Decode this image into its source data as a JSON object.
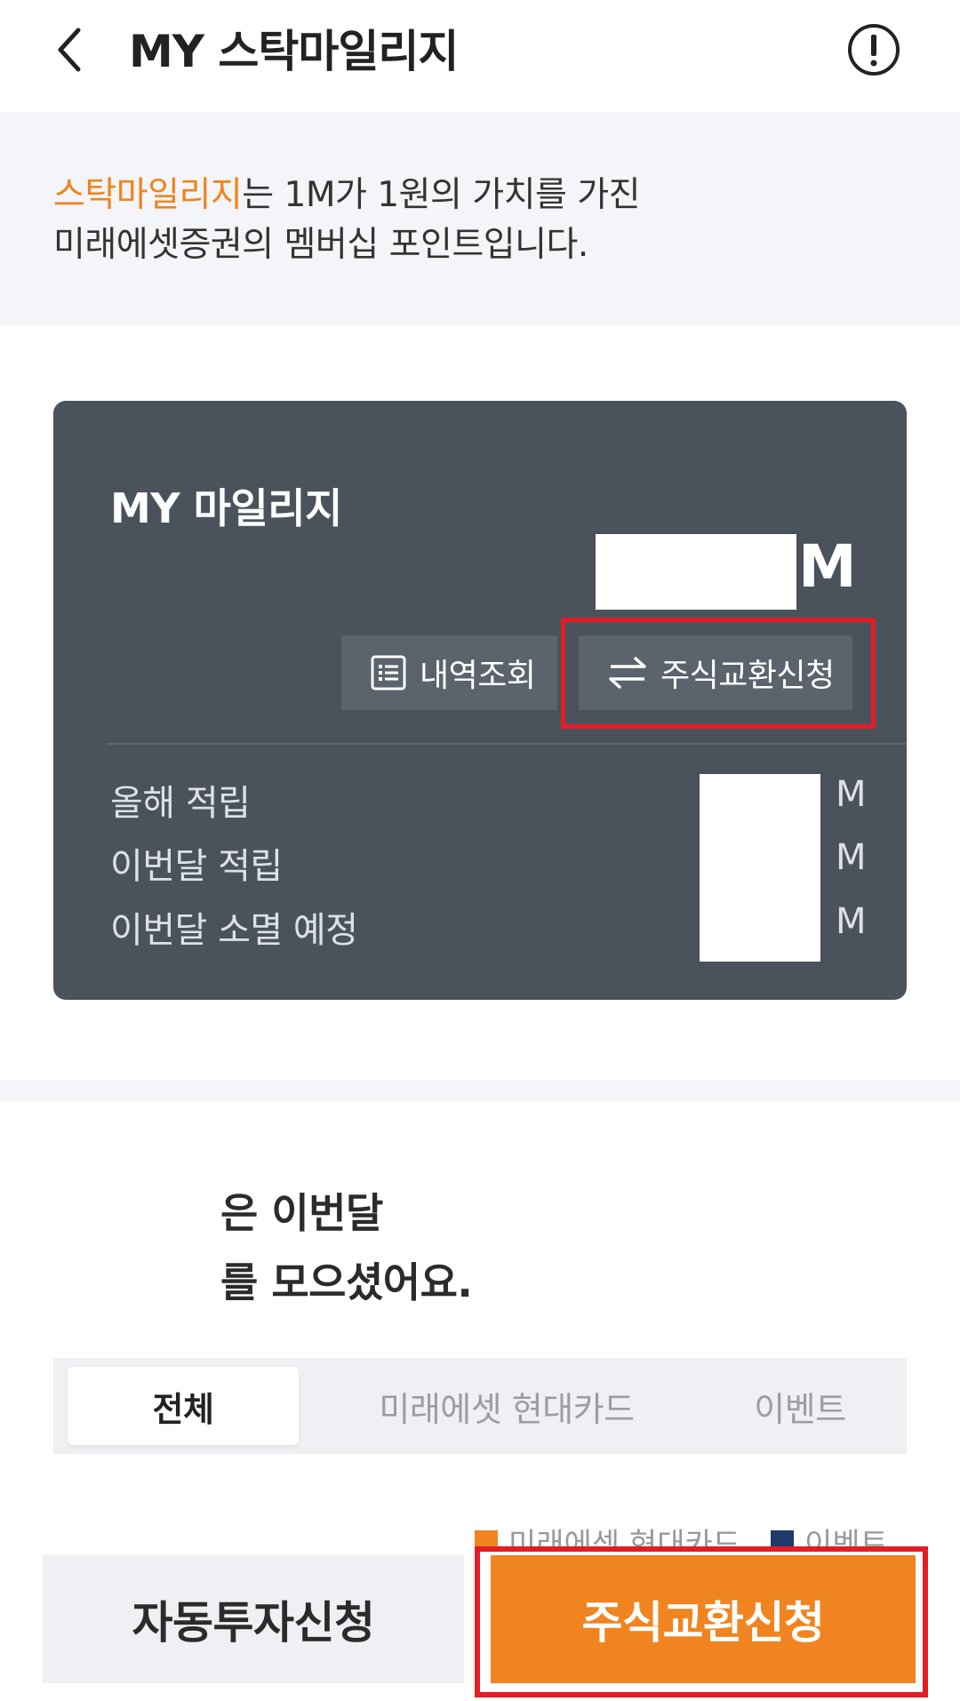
{
  "header": {
    "title": "MY 스탁마일리지",
    "back_icon": "chevron-left-icon",
    "info_icon": "exclamation-circle-icon"
  },
  "intro": {
    "highlight": "스탁마일리지",
    "line1_rest": "는 1M가 1원의 가치를 가진",
    "line2": "미래에셋증권의 멤버십 포인트입니다."
  },
  "card": {
    "title": "MY 마일리지",
    "balance_unit": "M",
    "history_button": "내역조회",
    "exchange_button": "주식교환신청",
    "stats": [
      {
        "label": "올해 적립",
        "unit": "M"
      },
      {
        "label": "이번달 적립",
        "unit": "M"
      },
      {
        "label": "이번달 소멸 예정",
        "unit": "M"
      }
    ]
  },
  "monthly": {
    "line1": "은 이번달",
    "line2": "를 모으셨어요."
  },
  "tabs": [
    {
      "label": "전체",
      "active": true
    },
    {
      "label": "미래에셋 현대카드",
      "active": false
    },
    {
      "label": "이벤트",
      "active": false
    }
  ],
  "legend": [
    {
      "label": "미래에셋 현대카드",
      "color": "#f08420"
    },
    {
      "label": "이벤트",
      "color": "#1f3a6b"
    }
  ],
  "bottom": {
    "auto_invest": "자동투자신청",
    "stock_exchange": "주식교환신청"
  },
  "colors": {
    "accent": "#f08420",
    "card_bg": "#4a535c",
    "highlight_border": "#e31c25"
  }
}
